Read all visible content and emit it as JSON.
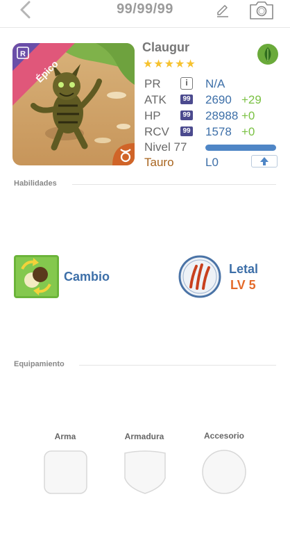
{
  "header": {
    "title": "99/99/99"
  },
  "card": {
    "rarity_label": "Épico",
    "rarity_letter": "R",
    "zodiac_icon": "taurus-icon",
    "element_icon": "leaf-icon",
    "accent_color": "#e0577a"
  },
  "monster": {
    "name": "Claugur",
    "stars": "★★★★★"
  },
  "stats": {
    "pr": {
      "label": "PR",
      "value": "N/A",
      "badge": "i"
    },
    "atk": {
      "label": "ATK",
      "badge": "99",
      "value": "2690",
      "plus": "+29"
    },
    "hp": {
      "label": "HP",
      "badge": "99",
      "value": "28988",
      "plus": "+0"
    },
    "rcv": {
      "label": "RCV",
      "badge": "99",
      "value": "1578",
      "plus": "+0"
    },
    "level": {
      "label": "Nivel 77",
      "progress": 1.0
    },
    "sign": {
      "label": "Tauro",
      "value": "L0"
    }
  },
  "sections": {
    "skills_title": "Habilidades",
    "equipment_title": "Equipamiento"
  },
  "skills": {
    "active_name": "Cambio",
    "ability_name": "Letal",
    "ability_level": "LV 5"
  },
  "equipment": {
    "weapon_label": "Arma",
    "armor_label": "Armadura",
    "accessory_label": "Accesorio"
  }
}
